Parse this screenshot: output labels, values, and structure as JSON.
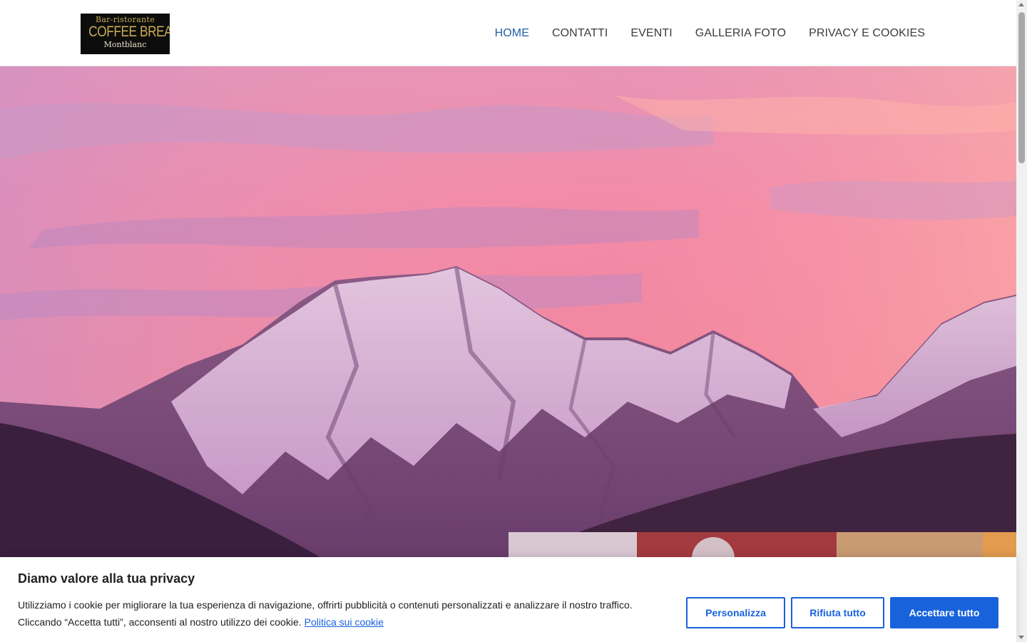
{
  "logo": {
    "line1": "Bar-ristorante",
    "line2": "COFFEE BREAK",
    "line3": "Montblanc"
  },
  "nav": {
    "items": [
      {
        "label": "HOME",
        "active": true
      },
      {
        "label": "CONTATTI",
        "active": false
      },
      {
        "label": "EVENTI",
        "active": false
      },
      {
        "label": "GALLERIA FOTO",
        "active": false
      },
      {
        "label": "PRIVACY E COOKIES",
        "active": false
      }
    ]
  },
  "cookie_banner": {
    "title": "Diamo valore alla tua privacy",
    "text_line1": "Utilizziamo i cookie per migliorare la tua esperienza di navigazione, offrirti pubblicità o contenuti personalizzati e analizzare il nostro traffico.",
    "text_line2": "Cliccando “Accetta tutti”, acconsenti al nostro utilizzo dei cookie.",
    "policy_link": "Politica sui cookie",
    "buttons": {
      "customize": "Personalizza",
      "reject": "Rifiuta tutto",
      "accept": "Accettare tutto"
    }
  },
  "colors": {
    "nav_active": "#1e5fa8",
    "cookie_accent": "#1863dc",
    "logo_gold": "#c9ab55"
  }
}
